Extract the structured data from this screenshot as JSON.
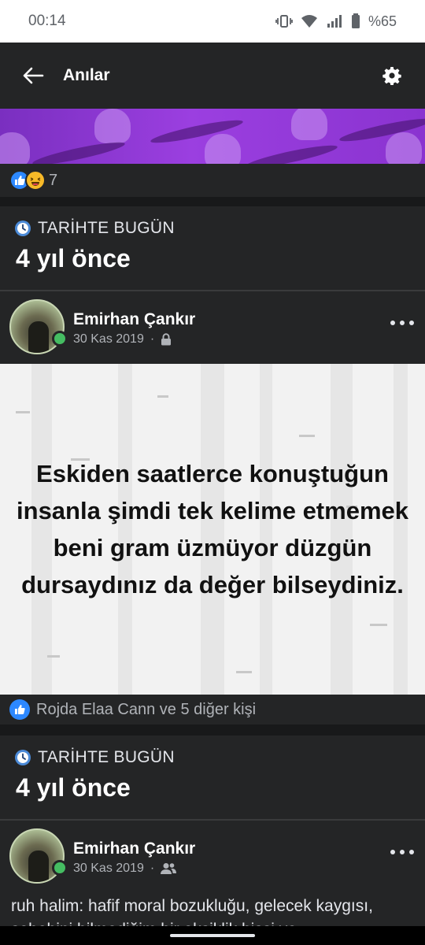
{
  "status_bar": {
    "time": "00:14",
    "battery": "%65"
  },
  "header": {
    "title": "Anılar"
  },
  "reactions": {
    "count": "7"
  },
  "sections": [
    {
      "label": "TARİHTE BUGÜN",
      "title": "4 yıl önce",
      "post": {
        "author": "Emirhan Çankır",
        "date": "30 Kas 2019",
        "separator": "·",
        "privacy_icon": "lock-icon",
        "text": "Eskiden saatlerce konuştuğun insanla şimdi tek kelime etmemek beni gram üzmüyor düzgün dursaydınız da değer bilseydiniz.",
        "likes": "Rojda Elaa Cann ve 5 diğer kişi"
      }
    },
    {
      "label": "TARİHTE BUGÜN",
      "title": "4 yıl önce",
      "post": {
        "author": "Emirhan Çankır",
        "date": "30 Kas 2019",
        "separator": "·",
        "privacy_icon": "friends-icon",
        "text": "ruh halim: hafif moral bozukluğu, gelecek kaygısı, sebebini bilmediğim bir eksiklik hissi ve"
      }
    }
  ],
  "colors": {
    "background": "#18191a",
    "surface": "#242526",
    "like_blue": "#2d88ff",
    "online_green": "#45bd62",
    "cover_purple": "#9b3fe0"
  }
}
